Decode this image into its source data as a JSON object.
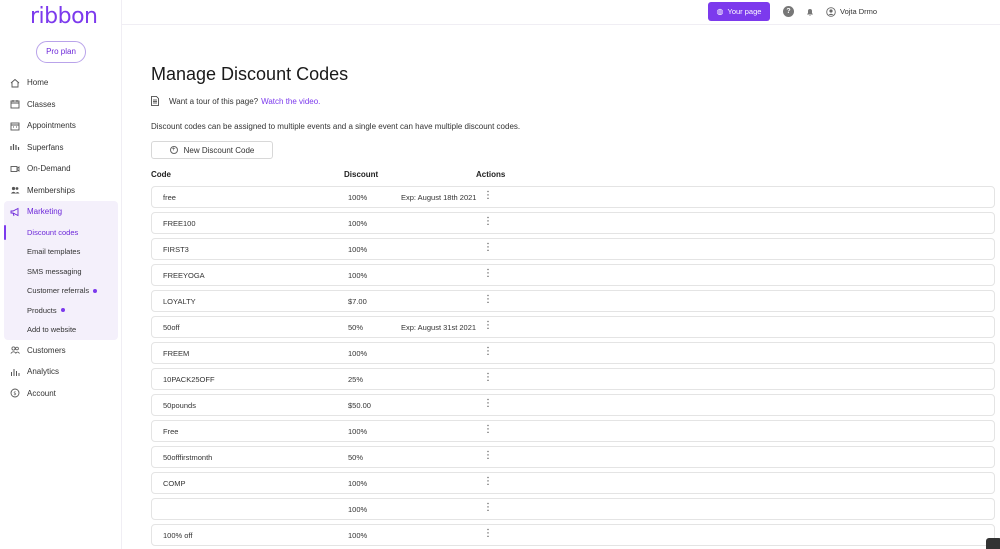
{
  "brand": {
    "logo": "ribbon",
    "plan": "Pro plan"
  },
  "topbar": {
    "your_page": "Your page",
    "user_name": "Vojta Drmo"
  },
  "nav": {
    "home": "Home",
    "classes": "Classes",
    "appointments": "Appointments",
    "superfans": "Superfans",
    "on_demand": "On-Demand",
    "memberships": "Memberships",
    "marketing": "Marketing",
    "marketing_sub": {
      "discount_codes": "Discount codes",
      "email_templates": "Email templates",
      "sms_messaging": "SMS messaging",
      "customer_referrals": "Customer referrals",
      "products": "Products",
      "add_to_website": "Add to website"
    },
    "customers": "Customers",
    "analytics": "Analytics",
    "account": "Account"
  },
  "page": {
    "title": "Manage Discount Codes",
    "tour_text": "Want a tour of this page?",
    "tour_link": "Watch the video.",
    "description": "Discount codes can be assigned to multiple events and a single event can have multiple discount codes.",
    "new_button": "New Discount Code"
  },
  "table": {
    "headers": {
      "code": "Code",
      "discount": "Discount",
      "actions": "Actions"
    },
    "rows": [
      {
        "code": "free",
        "discount": "100%",
        "exp": "Exp: August 18th 2021"
      },
      {
        "code": "FREE100",
        "discount": "100%",
        "exp": ""
      },
      {
        "code": "FIRST3",
        "discount": "100%",
        "exp": ""
      },
      {
        "code": "FREEYOGA",
        "discount": "100%",
        "exp": ""
      },
      {
        "code": "LOYALTY",
        "discount": "$7.00",
        "exp": ""
      },
      {
        "code": "50off",
        "discount": "50%",
        "exp": "Exp: August 31st 2021"
      },
      {
        "code": "FREEM",
        "discount": "100%",
        "exp": ""
      },
      {
        "code": "10PACK25OFF",
        "discount": "25%",
        "exp": ""
      },
      {
        "code": "50pounds",
        "discount": "$50.00",
        "exp": ""
      },
      {
        "code": "Free",
        "discount": "100%",
        "exp": ""
      },
      {
        "code": "50offfirstmonth",
        "discount": "50%",
        "exp": ""
      },
      {
        "code": "COMP",
        "discount": "100%",
        "exp": ""
      },
      {
        "code": "",
        "discount": "100%",
        "exp": ""
      },
      {
        "code": "100% off",
        "discount": "100%",
        "exp": ""
      }
    ]
  }
}
